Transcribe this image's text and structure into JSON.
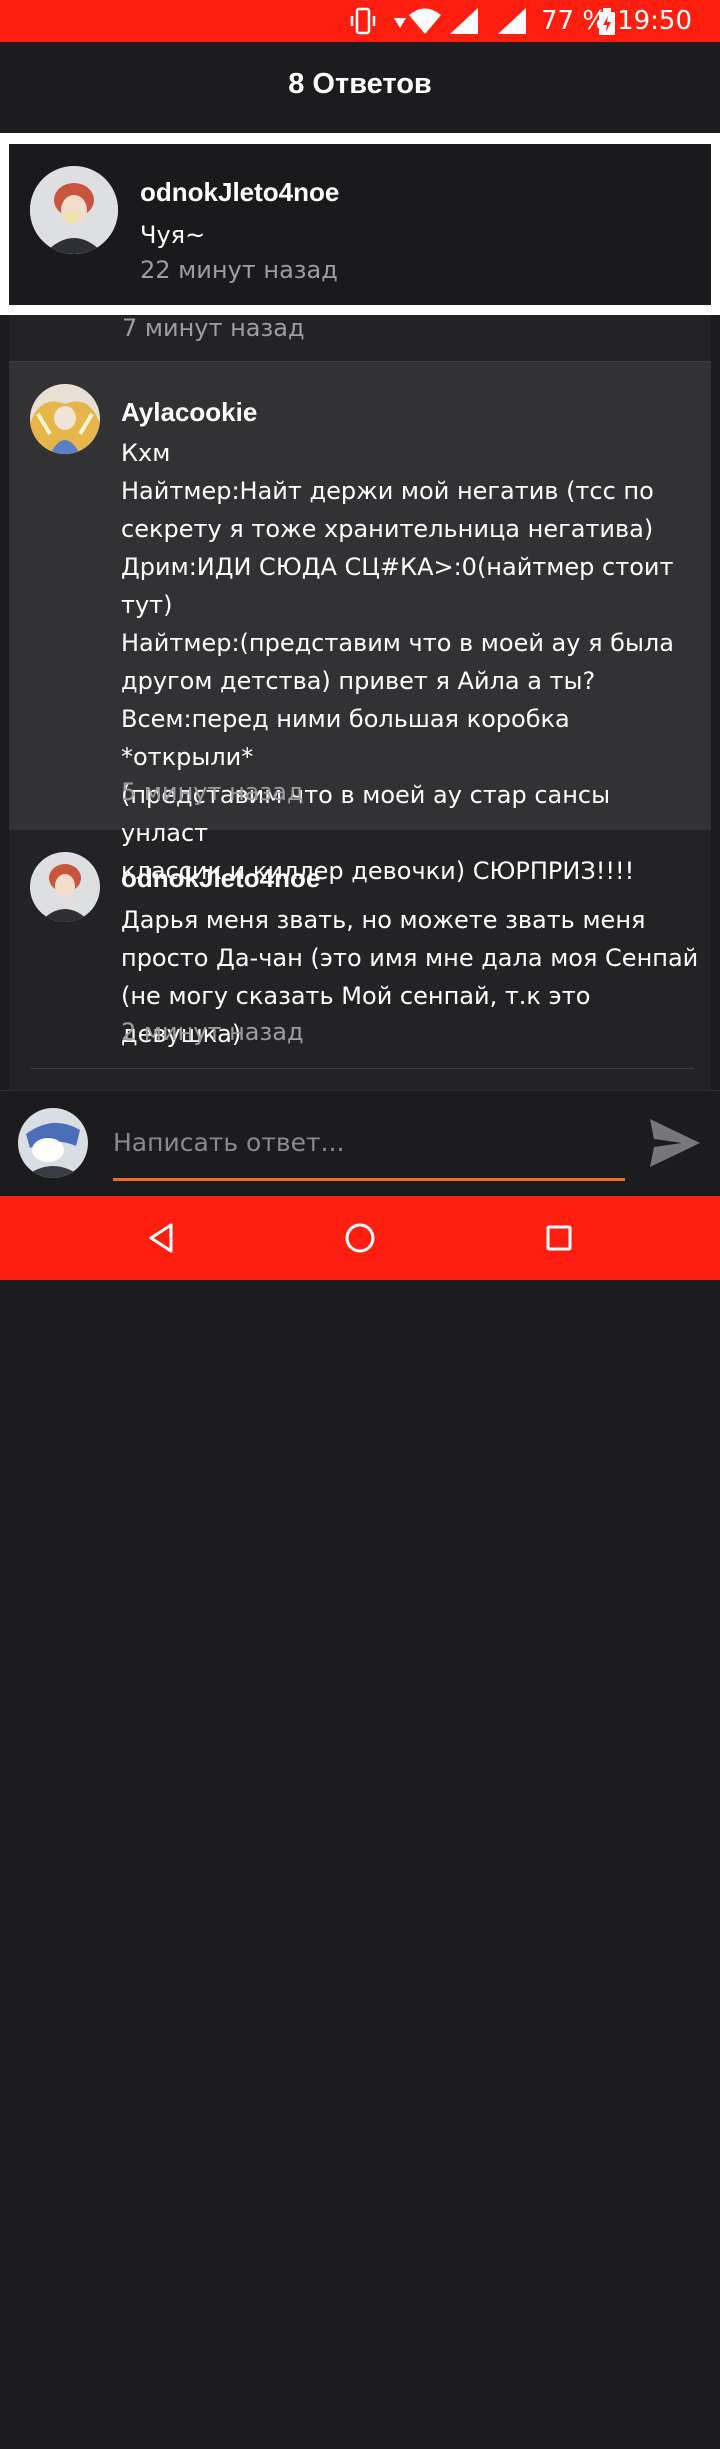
{
  "status_bar": {
    "battery_percent": "77 %",
    "time": "19:50"
  },
  "header": {
    "title": "8 Ответов"
  },
  "parent_comment": {
    "username": "odnokJleto4noe",
    "text": "Чуя~",
    "time": "22 минут назад"
  },
  "replies": {
    "partial_time": "7 минут назад",
    "items": [
      {
        "username": "Aylacookie",
        "lines": [
          "Кхм",
          "Найтмер:Найт держи мой негатив (тсс по",
          "секрету я тоже хранительница негатива)",
          "Дрим:ИДИ СЮДА СЦ#КА>:0(найтмер стоит тут)",
          "Найтмер:(представим что в моей ау я была",
          "другом детства) привет я Айла а ты?",
          "Всем:перед ними большая коробка *открыли*",
          "(представим что в моей ау стар сансы унласт",
          "классик и киллер девочки) СЮРПРИЗ!!!!"
        ],
        "time": "5 минут назад"
      },
      {
        "username": "odnokJleto4noe",
        "lines": [
          "Дарья меня звать, но можете звать меня",
          "просто Да-чан (это имя мне дала моя Сенпай",
          "(не могу сказать Мой сенпай, т.к это девушка)"
        ],
        "time": "2 минут назад"
      }
    ]
  },
  "reply_box": {
    "placeholder": "Написать ответ..."
  },
  "colors": {
    "accent": "#fe1f10",
    "underline": "#f26b1f",
    "background": "#1c1b1d",
    "highlight": "#323133"
  }
}
